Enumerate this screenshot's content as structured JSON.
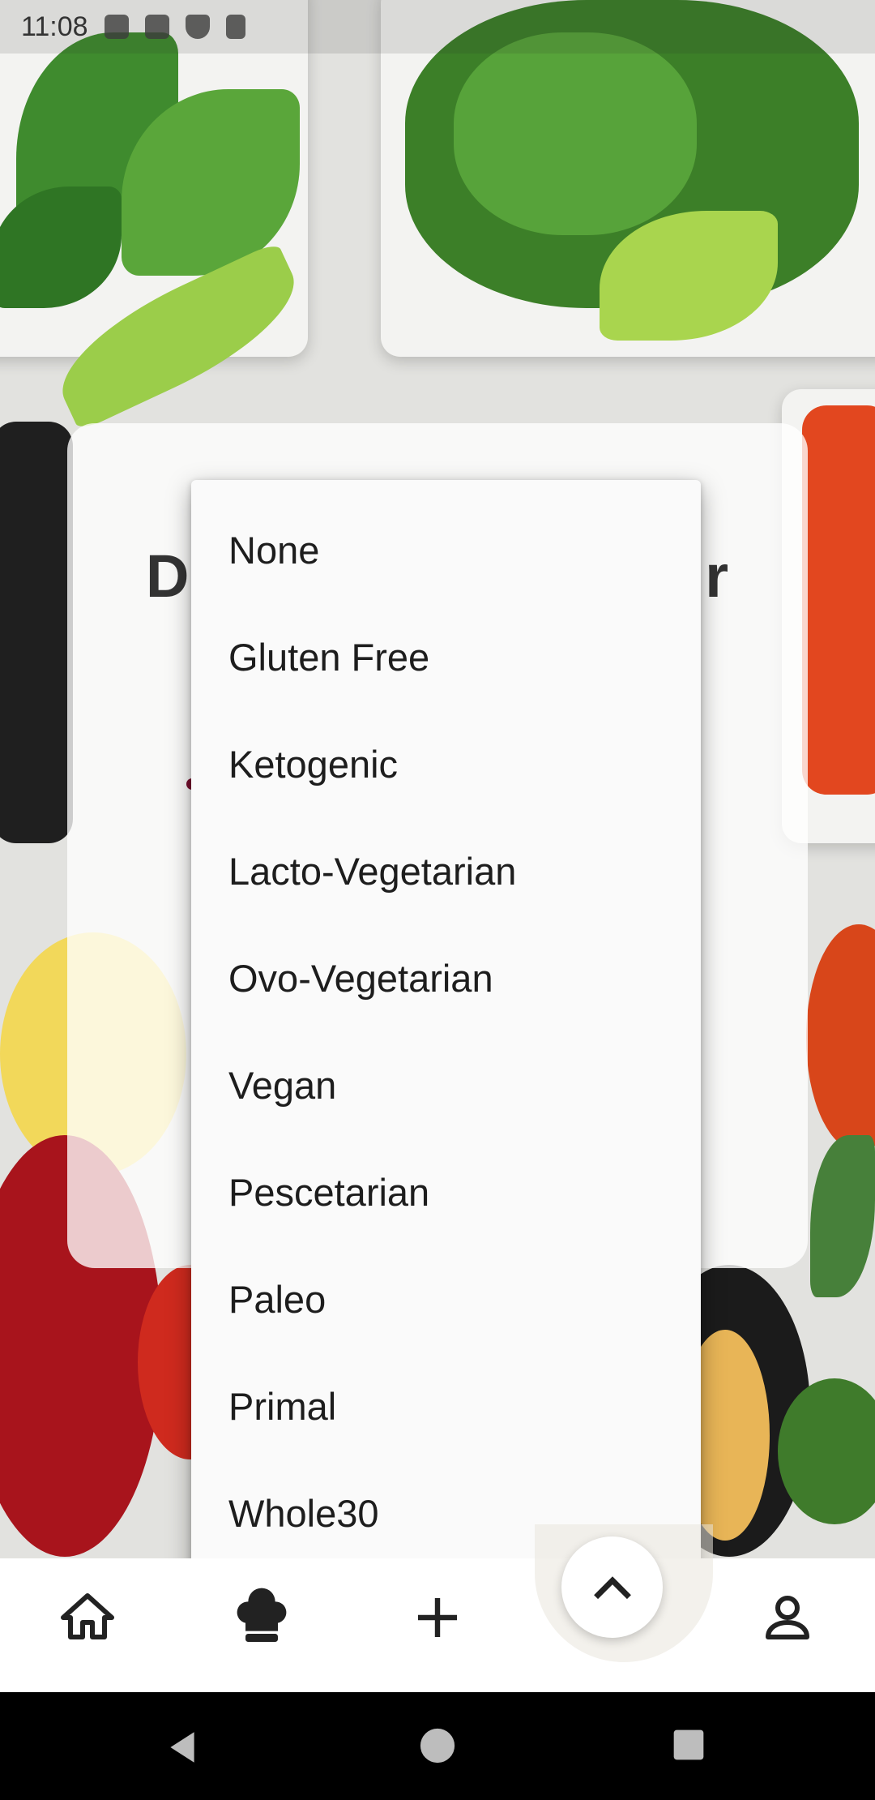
{
  "status_bar": {
    "time": "11:08",
    "icons": [
      "gear-icon",
      "gmail-icon",
      "shield-icon",
      "sd-card-icon"
    ]
  },
  "dialog": {
    "title_left": "D",
    "title_right": "r"
  },
  "dropdown": {
    "options": [
      "None",
      "Gluten Free",
      "Ketogenic",
      "Lacto-Vegetarian",
      "Ovo-Vegetarian",
      "Vegan",
      "Pescetarian",
      "Paleo",
      "Primal",
      "Whole30"
    ]
  },
  "bottom_nav": {
    "items": [
      "home-icon",
      "chef-hat-icon",
      "add-icon",
      "expand-up-icon",
      "profile-icon"
    ]
  },
  "system_nav": {
    "items": [
      "back-icon",
      "home-circle-icon",
      "recents-icon"
    ]
  }
}
